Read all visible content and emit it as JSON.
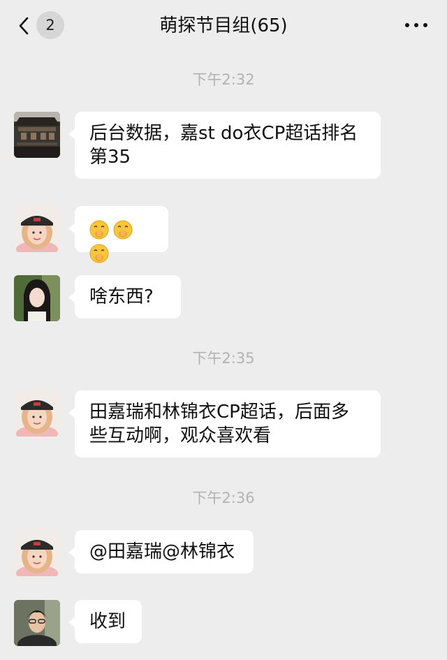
{
  "header": {
    "unread_count": "2",
    "title": "萌探节目组(65)"
  },
  "timestamps": [
    "下午2:32",
    "下午2:35",
    "下午2:36"
  ],
  "messages": [
    {
      "sender_avatar": "building-photo-avatar",
      "text": "后台数据，嘉st do衣CP超话排名第35"
    },
    {
      "sender_avatar": "cap-girl-avatar",
      "text": "",
      "emojis": [
        "shush-face-emoji",
        "shush-face-emoji",
        "shush-face-emoji"
      ]
    },
    {
      "sender_avatar": "long-hair-woman-avatar",
      "text": "啥东西?"
    },
    {
      "sender_avatar": "cap-girl-avatar",
      "text": "田嘉瑞和林锦衣CP超话，后面多些互动啊，观众喜欢看"
    },
    {
      "sender_avatar": "cap-girl-avatar",
      "text": "@田嘉瑞@林锦衣"
    },
    {
      "sender_avatar": "young-man-avatar",
      "text": "收到"
    }
  ],
  "colors": {
    "background": "#ededed",
    "bubble": "#ffffff",
    "timestamp": "#b2b2b2",
    "badge": "#d6d6d6"
  }
}
